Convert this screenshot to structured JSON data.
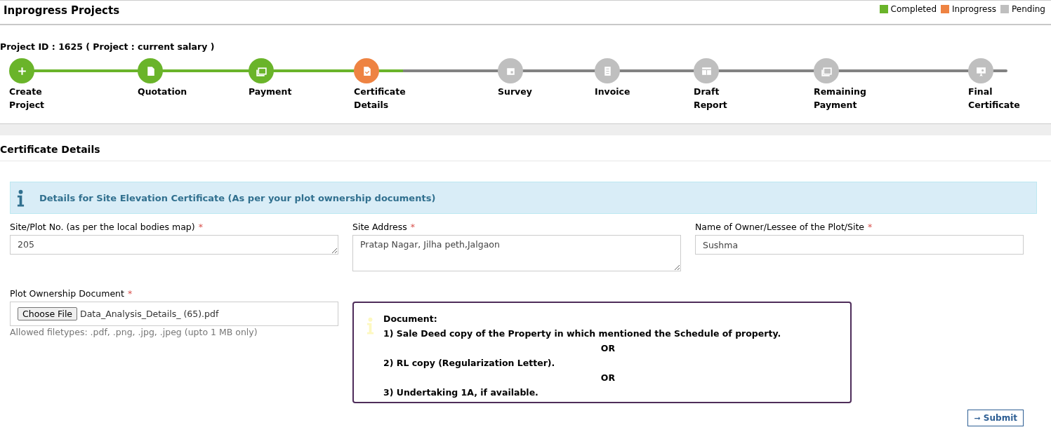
{
  "header": {
    "title": "Inprogress Projects",
    "legend": [
      {
        "label": "Completed",
        "color": "#6ab42a"
      },
      {
        "label": "Inprogress",
        "color": "#ee8342"
      },
      {
        "label": "Pending",
        "color": "#bfbfbf"
      }
    ]
  },
  "project_line": "Project ID : 1625 ( Project : current salary )",
  "steps": [
    {
      "label": "Create Project",
      "completed": true,
      "in_progress": false
    },
    {
      "label": "Quotation",
      "completed": true,
      "in_progress": false
    },
    {
      "label": "Payment",
      "completed": true,
      "in_progress": false
    },
    {
      "label": "Certificate Details",
      "completed": false,
      "in_progress": true
    },
    {
      "label": "Survey",
      "completed": false,
      "in_progress": false
    },
    {
      "label": "Invoice",
      "completed": false,
      "in_progress": false
    },
    {
      "label": "Draft Report",
      "completed": false,
      "in_progress": false
    },
    {
      "label": "Remaining Payment",
      "completed": false,
      "in_progress": false
    },
    {
      "label": "Final Certificate",
      "completed": false,
      "in_progress": false
    }
  ],
  "section_title": "Certificate Details",
  "alert": "Details for Site Elevation Certificate (As per your plot ownership documents)",
  "fields": [
    {
      "label": "Site/Plot No. (as per the local bodies map)",
      "required_mark": "*",
      "kind": "textarea",
      "value": "205"
    },
    {
      "label": "Site Address",
      "required_mark": "*",
      "kind": "textarea_tall",
      "value": "Pratap Nagar, Jilha peth,Jalgaon"
    },
    {
      "label": "Name of Owner/Lessee of the Plot/Site",
      "required_mark": "*",
      "kind": "input",
      "value": "Sushma"
    }
  ],
  "upload": {
    "label": "Plot Ownership Document",
    "required_mark": "*",
    "button": "Choose File",
    "file_name": "Data_Analysis_Details_ (65).pdf",
    "hint": "Allowed filetypes: .pdf, .png, .jpg, .jpeg (upto 1 MB only)"
  },
  "document_note": {
    "lines": [
      {
        "text": "Document:",
        "kind": "line"
      },
      {
        "text": "1) Sale Deed copy of the Property in which mentioned the Schedule of property.",
        "kind": "line"
      },
      {
        "text": "OR",
        "kind": "separator"
      },
      {
        "text": "2) RL copy (Regularization Letter).",
        "kind": "line"
      },
      {
        "text": "OR",
        "kind": "separator"
      },
      {
        "text": "3) Undertaking 1A, if available.",
        "kind": "line"
      }
    ]
  },
  "submit": {
    "arrow": "➞",
    "label": "Submit"
  }
}
